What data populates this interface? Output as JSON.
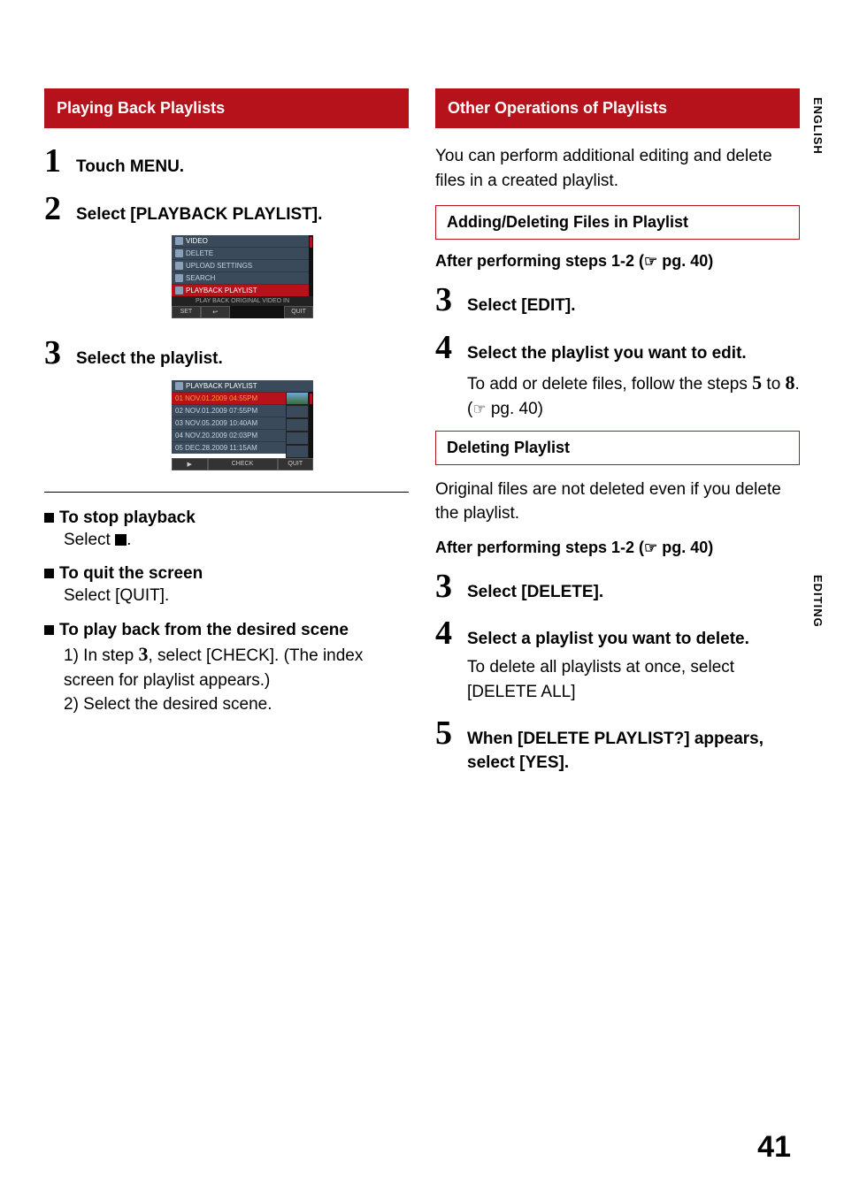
{
  "page_number": "41",
  "side_labels": {
    "lang": "ENGLISH",
    "section": "EDITING"
  },
  "left": {
    "bar": "Playing Back Playlists",
    "step1": {
      "title": "Touch MENU."
    },
    "step2": {
      "title": "Select [PLAYBACK PLAYLIST].",
      "ui": {
        "header": "VIDEO",
        "rows": [
          "DELETE",
          "UPLOAD SETTINGS",
          "SEARCH",
          "PLAYBACK PLAYLIST"
        ],
        "helper": "PLAY BACK ORIGINAL VIDEO IN",
        "footer": [
          "SET",
          "↩",
          "",
          "QUIT"
        ]
      }
    },
    "step3": {
      "title": "Select the playlist.",
      "ui": {
        "header": "PLAYBACK PLAYLIST",
        "rows": [
          "01 NOV.01.2009 04:55PM",
          "02 NOV.01.2009 07:55PM",
          "03 NOV.05.2009 10:40AM",
          "04 NOV.20.2009 02:03PM",
          "05 DEC.28.2009 11:15AM"
        ],
        "footer": [
          "▶",
          "CHECK",
          "QUIT"
        ]
      }
    },
    "bullets": {
      "b1_head": "To stop playback",
      "b1_body_prefix": "Select ",
      "b1_body_suffix": ".",
      "b2_head": "To quit the screen",
      "b2_body": "Select [QUIT].",
      "b3_head": "To play back from the desired scene",
      "b3_line1_a": "1) In step ",
      "b3_line1_num": "3",
      "b3_line1_b": ", select [CHECK]. (The index screen for playlist appears.)",
      "b3_line2": "2) Select the desired scene."
    }
  },
  "right": {
    "bar": "Other Operations of Playlists",
    "intro": "You can perform additional editing and delete files in a created playlist.",
    "sub1": "Adding/Deleting Files in Playlist",
    "after1_a": "After performing steps 1-2 (",
    "after1_b": " pg. 40)",
    "step3": {
      "title": "Select [EDIT]."
    },
    "step4": {
      "title": "Select the playlist you want to edit.",
      "sub_a": "To add or delete files, follow the steps ",
      "sub_5": "5",
      "sub_b": " to ",
      "sub_8": "8",
      "sub_c": ". (",
      "sub_d": " pg. 40)"
    },
    "sub2": "Deleting Playlist",
    "para2": "Original files are not deleted even if you delete the playlist.",
    "after2_a": "After performing steps 1-2 (",
    "after2_b": " pg. 40)",
    "step3b": {
      "title": "Select [DELETE]."
    },
    "step4b": {
      "title": "Select a playlist you want to delete.",
      "sub": "To delete all playlists at once, select [DELETE ALL]"
    },
    "step5": {
      "title": "When [DELETE PLAYLIST?] appears, select [YES]."
    }
  }
}
